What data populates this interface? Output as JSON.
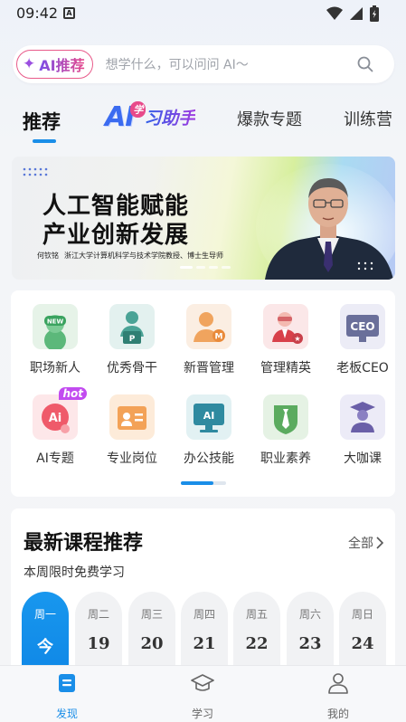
{
  "status_bar": {
    "time": "09:42",
    "notif": "A"
  },
  "search": {
    "ai_label": "AI推荐",
    "placeholder": "想学什么，可以问问 AI～"
  },
  "tabs": [
    {
      "label": "推荐"
    },
    {
      "label_ai": "AI",
      "label_xue": "学",
      "label_rest": "习助手"
    },
    {
      "label": "爆款专题"
    },
    {
      "label": "训练营"
    }
  ],
  "banner": {
    "title_line1": "人工智能赋能",
    "title_line2": "产业创新发展",
    "speaker_name": "何钦铭",
    "speaker_desc": "浙江大学计算机科学与技术学院教授、博士生导师"
  },
  "categories": [
    {
      "label": "职场新人",
      "icon": "new-badge-person-icon",
      "badge": "NEW"
    },
    {
      "label": "优秀骨干",
      "icon": "presenter-icon",
      "badge": "P"
    },
    {
      "label": "新晋管理",
      "icon": "manager-m-icon",
      "badge": "M"
    },
    {
      "label": "管理精英",
      "icon": "executive-icon"
    },
    {
      "label": "老板CEO",
      "icon": "ceo-icon",
      "badge": "CEO"
    },
    {
      "label": "AI专题",
      "icon": "ai-bot-icon",
      "hot": "hot",
      "badge": "Ai"
    },
    {
      "label": "专业岗位",
      "icon": "id-card-icon"
    },
    {
      "label": "办公技能",
      "icon": "ai-monitor-icon",
      "badge": "AI"
    },
    {
      "label": "职业素养",
      "icon": "necktie-icon"
    },
    {
      "label": "大咖课",
      "icon": "graduate-icon"
    }
  ],
  "courses": {
    "title": "最新课程推荐",
    "all_label": "全部",
    "subtitle": "本周限时免费学习",
    "days": [
      {
        "weekday": "周一",
        "date": "今",
        "active": true
      },
      {
        "weekday": "周二",
        "date": "19"
      },
      {
        "weekday": "周三",
        "date": "20"
      },
      {
        "weekday": "周四",
        "date": "21"
      },
      {
        "weekday": "周五",
        "date": "22"
      },
      {
        "weekday": "周六",
        "date": "23"
      },
      {
        "weekday": "周日",
        "date": "24"
      }
    ]
  },
  "bottom_nav": [
    {
      "label": "发现",
      "icon": "discover-icon",
      "active": true
    },
    {
      "label": "学习",
      "icon": "graduation-cap-icon"
    },
    {
      "label": "我的",
      "icon": "profile-icon"
    }
  ],
  "colors": {
    "accent": "#1a8ee8",
    "ai_purple": "#8a4bd6",
    "hot_pink": "#e85a8a"
  }
}
